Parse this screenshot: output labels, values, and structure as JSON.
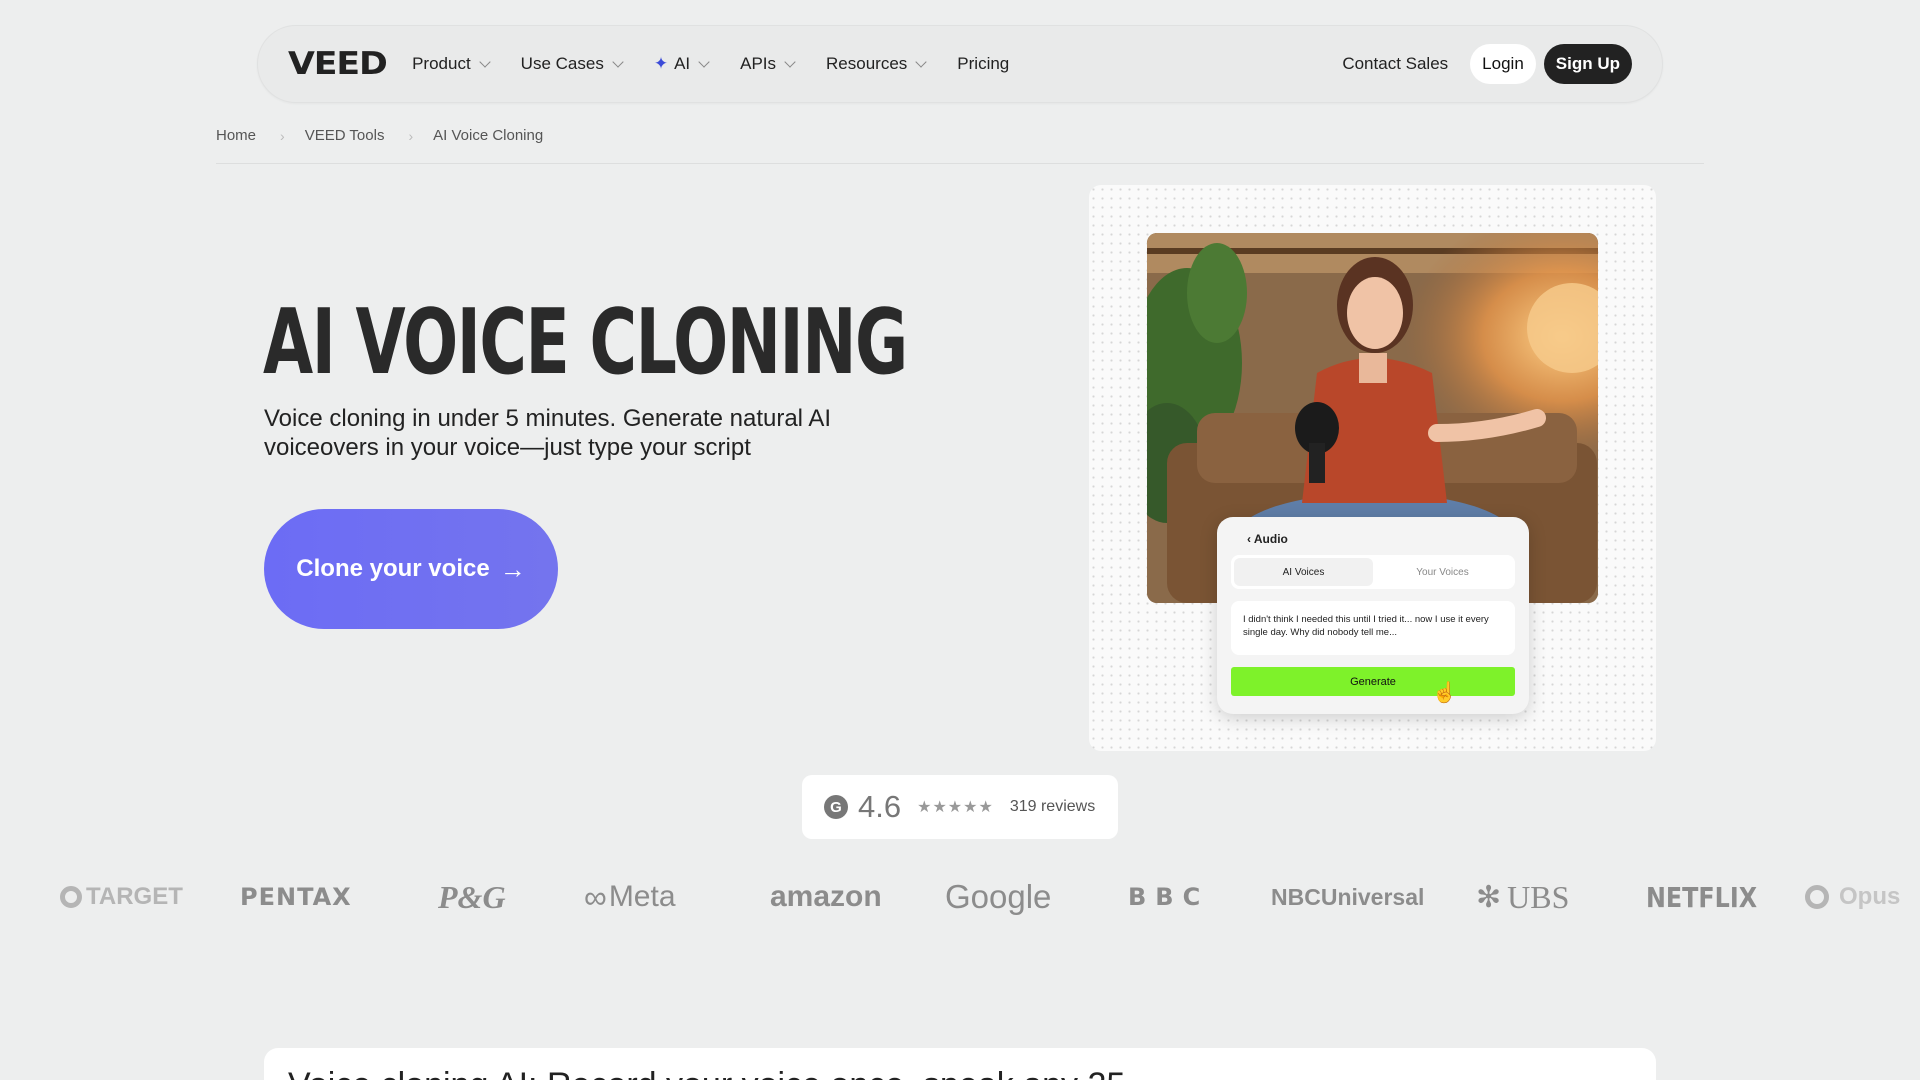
{
  "nav": {
    "logo": "VEED",
    "items": [
      {
        "label": "Product",
        "has_chevron": true
      },
      {
        "label": "Use Cases",
        "has_chevron": true
      },
      {
        "label": "AI",
        "has_chevron": true,
        "icon": "sparkle-icon"
      },
      {
        "label": "APIs",
        "has_chevron": true
      },
      {
        "label": "Resources",
        "has_chevron": true
      },
      {
        "label": "Pricing",
        "has_chevron": false
      }
    ],
    "contact": "Contact Sales",
    "login": "Login",
    "signup": "Sign Up"
  },
  "breadcrumb": [
    "Home",
    "VEED Tools",
    "AI Voice Cloning"
  ],
  "hero": {
    "title": "AI VOICE CLONING",
    "subtitle": "Voice cloning in under 5 minutes. Generate natural AI voiceovers in your voice—just type your script",
    "cta": "Clone your voice",
    "cta_arrow": "→"
  },
  "panel": {
    "back": "‹ Audio",
    "tabs": [
      "AI Voices",
      "Your Voices"
    ],
    "active_tab": 0,
    "script": "I didn't think I needed this until I tried it... now I use it every single day. Why did nobody tell me...",
    "generate": "Generate"
  },
  "rating": {
    "icon": "G",
    "score": "4.6",
    "stars": "★★★★★",
    "reviews": "319 reviews"
  },
  "logos": [
    "TARGET",
    "PENTAX",
    "P&G",
    "Meta",
    "amazon",
    "Google",
    "BBC",
    "NBCUniversal",
    "UBS",
    "NETFLIX",
    "Opus"
  ],
  "bottom": {
    "heading": "Voice cloning AI: Record your voice once, speak any 25"
  },
  "colors": {
    "background": "#edeeee",
    "cta": "#6c6cf5",
    "generate": "#7ef22a",
    "signup": "#222222"
  }
}
